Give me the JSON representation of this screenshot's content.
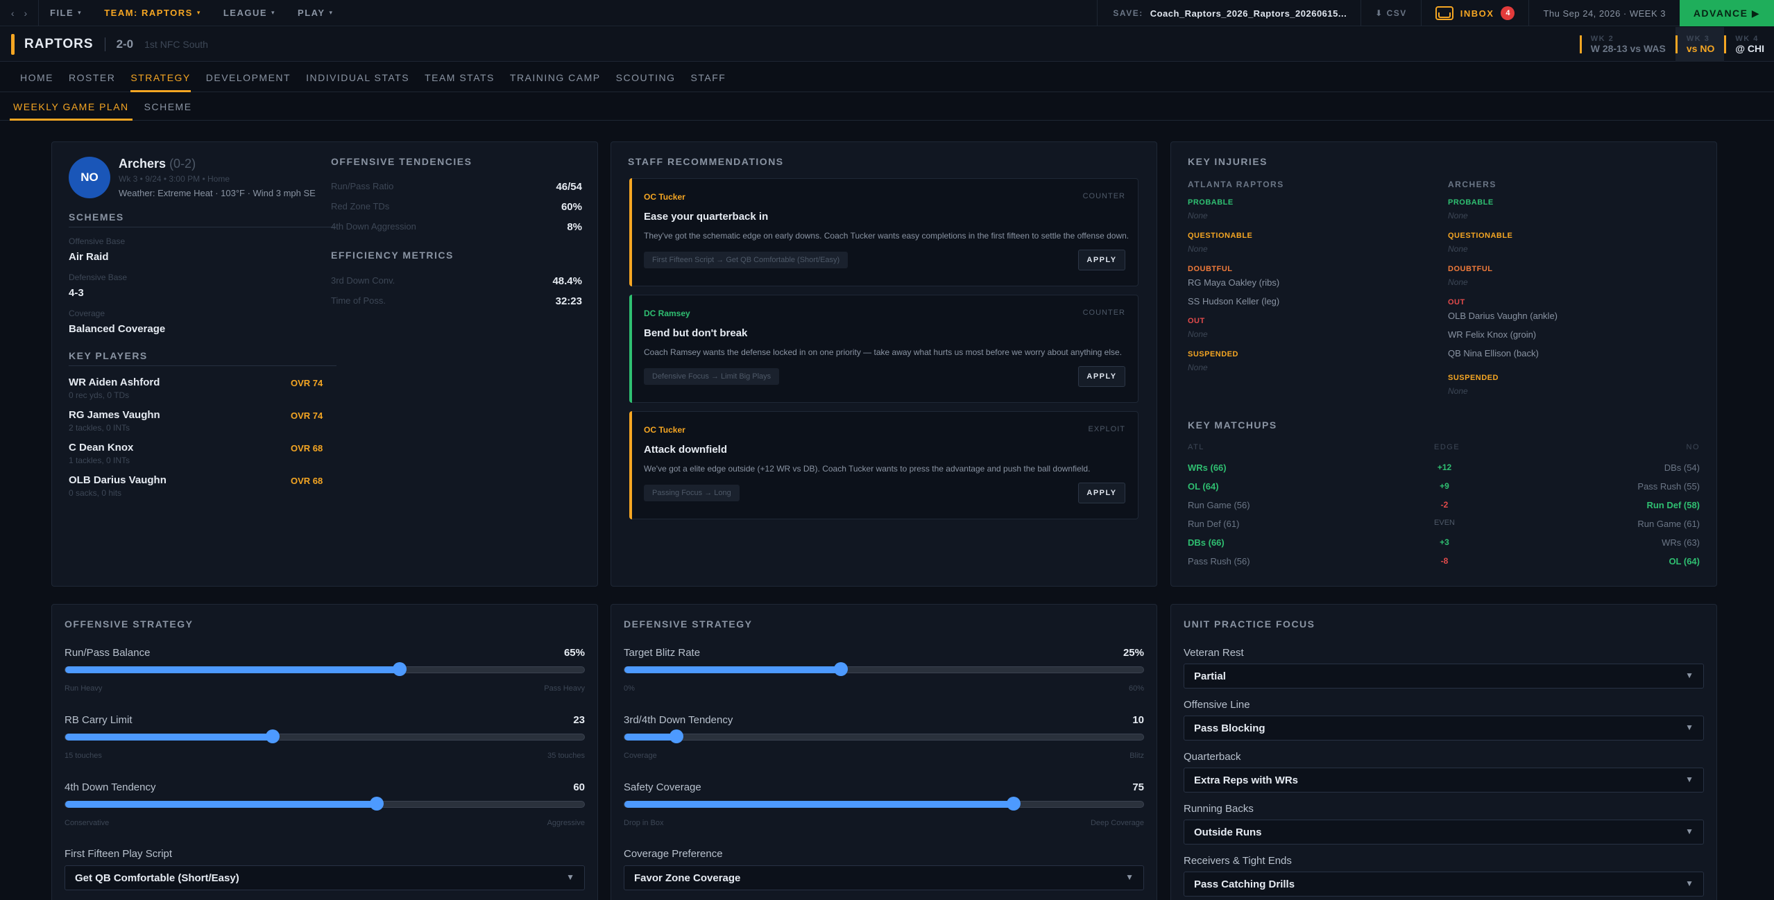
{
  "topbar": {
    "back": "‹",
    "forward": "›",
    "menus": [
      {
        "label": "FILE"
      },
      {
        "label": "TEAM: RAPTORS"
      },
      {
        "label": "LEAGUE"
      },
      {
        "label": "PLAY"
      }
    ],
    "save_label": "SAVE:",
    "save_value": "Coach_Raptors_2026_Raptors_20260615...",
    "csv": "CSV",
    "inbox_label": "INBOX",
    "inbox_count": "4",
    "date": "Thu Sep 24, 2026 · WEEK 3",
    "advance": "ADVANCE ▶"
  },
  "team": {
    "name": "RAPTORS",
    "record": "2-0",
    "division": "1st NFC South",
    "weeks": [
      {
        "label": "WK 2",
        "value": "W 28-13 vs WAS"
      },
      {
        "label": "WK 3",
        "value": "vs NO"
      },
      {
        "label": "WK 4",
        "value": "@ CHI"
      }
    ]
  },
  "nav": [
    "HOME",
    "ROSTER",
    "STRATEGY",
    "DEVELOPMENT",
    "INDIVIDUAL STATS",
    "TEAM STATS",
    "TRAINING CAMP",
    "SCOUTING",
    "STAFF"
  ],
  "subnav": [
    "WEEKLY GAME PLAN",
    "SCHEME"
  ],
  "opponent": {
    "abbr": "NO",
    "name": "Archers",
    "record": "(0-2)",
    "meta": "Wk 3 • 9/24 • 3:00 PM • Home",
    "weather": "Weather: Extreme Heat · 103°F · Wind 3 mph SE",
    "schemes_title": "SCHEMES",
    "offensive_base_label": "Offensive Base",
    "offensive_base": "Air Raid",
    "defensive_base_label": "Defensive Base",
    "defensive_base": "4-3",
    "coverage_label": "Coverage",
    "coverage": "Balanced Coverage",
    "key_players_title": "KEY PLAYERS",
    "key_players": [
      {
        "name": "WR Aiden Ashford",
        "sub": "0 rec yds, 0 TDs",
        "ovr": "OVR 74"
      },
      {
        "name": "RG James Vaughn",
        "sub": "2 tackles, 0 INTs",
        "ovr": "OVR 74"
      },
      {
        "name": "C Dean Knox",
        "sub": "1 tackles, 0 INTs",
        "ovr": "OVR 68"
      },
      {
        "name": "OLB Darius Vaughn",
        "sub": "0 sacks, 0 hits",
        "ovr": "OVR 68"
      }
    ],
    "tendencies_title": "OFFENSIVE TENDENCIES",
    "tendencies": [
      {
        "label": "Run/Pass Ratio",
        "value": "46/54"
      },
      {
        "label": "Red Zone TDs",
        "value": "60%"
      },
      {
        "label": "4th Down Aggression",
        "value": "8%"
      }
    ],
    "efficiency_title": "EFFICIENCY METRICS",
    "efficiency": [
      {
        "label": "3rd Down Conv.",
        "value": "48.4%"
      },
      {
        "label": "Time of Poss.",
        "value": "32:23"
      }
    ]
  },
  "staff": {
    "title": "STAFF RECOMMENDATIONS",
    "recs": [
      {
        "coach": "OC Tucker",
        "tag": "COUNTER",
        "title": "Ease your quarterback in",
        "desc": "They've got the schematic edge on early downs. Coach Tucker wants easy completions in the first fifteen to settle the offense down.",
        "chip": "First Fifteen Script → Get QB Comfortable (Short/Easy)",
        "apply": "APPLY",
        "color": "#f5a623"
      },
      {
        "coach": "DC Ramsey",
        "tag": "COUNTER",
        "title": "Bend but don't break",
        "desc": "Coach Ramsey wants the defense locked in on one priority — take away what hurts us most before we worry about anything else.",
        "chip": "Defensive Focus → Limit Big Plays",
        "apply": "APPLY",
        "color": "#2fbf71"
      },
      {
        "coach": "OC Tucker",
        "tag": "EXPLOIT",
        "title": "Attack downfield",
        "desc": "We've got a elite edge outside (+12 WR vs DB). Coach Tucker wants to press the advantage and push the ball downfield.",
        "chip": "Passing Focus → Long",
        "apply": "APPLY",
        "color": "#f5a623"
      }
    ]
  },
  "injuries": {
    "title": "KEY INJURIES",
    "left_team": "ATLANTA RAPTORS",
    "right_team": "ARCHERS",
    "none": "None",
    "probable": "PROBABLE",
    "questionable": "QUESTIONABLE",
    "doubtful": "DOUBTFUL",
    "out": "OUT",
    "suspended": "SUSPENDED",
    "left_doubtful": [
      "RG Maya Oakley (ribs)",
      "SS Hudson Keller (leg)"
    ],
    "right_out": [
      "OLB Darius Vaughn (ankle)",
      "WR Felix Knox (groin)",
      "QB Nina Ellison (back)"
    ]
  },
  "matchups": {
    "title": "KEY MATCHUPS",
    "head": {
      "left": "ATL",
      "mid": "EDGE",
      "right": "NO"
    },
    "rows": [
      {
        "left": "WRs (66)",
        "edge": "+12",
        "right": "DBs (54)",
        "win": "left"
      },
      {
        "left": "OL (64)",
        "edge": "+9",
        "right": "Pass Rush (55)",
        "win": "left"
      },
      {
        "left": "Run Game (56)",
        "edge": "-2",
        "right": "Run Def (58)",
        "win": "right"
      },
      {
        "left": "Run Def (61)",
        "edge": "EVEN",
        "right": "Run Game (61)",
        "win": "even"
      },
      {
        "left": "DBs (66)",
        "edge": "+3",
        "right": "WRs (63)",
        "win": "left"
      },
      {
        "left": "Pass Rush (56)",
        "edge": "-8",
        "right": "OL (64)",
        "win": "right"
      }
    ]
  },
  "offense": {
    "title": "OFFENSIVE STRATEGY",
    "sliders": [
      {
        "label": "Run/Pass Balance",
        "value": "65%",
        "fraction": 0.645,
        "min": "Run Heavy",
        "max": "Pass Heavy"
      },
      {
        "label": "RB Carry Limit",
        "value": "23",
        "fraction": 0.4,
        "min": "15 touches",
        "max": "35 touches"
      },
      {
        "label": "4th Down Tendency",
        "value": "60",
        "fraction": 0.6,
        "min": "Conservative",
        "max": "Aggressive"
      }
    ],
    "script_label": "First Fifteen Play Script",
    "script_value": "Get QB Comfortable (Short/Easy)"
  },
  "defense": {
    "title": "DEFENSIVE STRATEGY",
    "sliders": [
      {
        "label": "Target Blitz Rate",
        "value": "25%",
        "fraction": 0.417,
        "min": "0%",
        "max": "60%"
      },
      {
        "label": "3rd/4th Down Tendency",
        "value": "10",
        "fraction": 0.1,
        "min": "Coverage",
        "max": "Blitz"
      },
      {
        "label": "Safety Coverage",
        "value": "75",
        "fraction": 0.75,
        "min": "Drop in Box",
        "max": "Deep Coverage"
      }
    ],
    "coverage_label": "Coverage Preference",
    "coverage_value": "Favor Zone Coverage"
  },
  "practice": {
    "title": "UNIT PRACTICE FOCUS",
    "items": [
      {
        "label": "Veteran Rest",
        "value": "Partial"
      },
      {
        "label": "Offensive Line",
        "value": "Pass Blocking"
      },
      {
        "label": "Quarterback",
        "value": "Extra Reps with WRs"
      },
      {
        "label": "Running Backs",
        "value": "Outside Runs"
      },
      {
        "label": "Receivers & Tight Ends",
        "value": "Pass Catching Drills"
      }
    ]
  },
  "colors": {
    "accent": "#f5a623",
    "green": "#2fbf71",
    "red": "#e24b4b",
    "blue": "#4d9aff",
    "advance": "#1fae5b"
  }
}
